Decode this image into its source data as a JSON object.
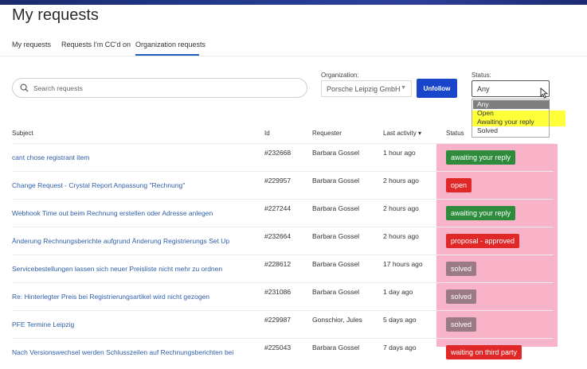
{
  "page_title": "My requests",
  "tabs": [
    {
      "label": "My requests"
    },
    {
      "label": "Requests I'm CC'd on"
    },
    {
      "label": "Organization requests"
    }
  ],
  "search": {
    "placeholder": "Search requests"
  },
  "organization": {
    "label": "Organization:",
    "value": "Porsche Leipzig GmbH"
  },
  "unfollow_label": "Unfollow",
  "status_filter": {
    "label": "Status:",
    "value": "Any",
    "options": [
      "Any",
      "Open",
      "Awaiting your reply",
      "Solved"
    ]
  },
  "table": {
    "headers": {
      "subject": "Subject",
      "id": "Id",
      "requester": "Requester",
      "last_activity": "Last activity ▾",
      "status": "Status"
    },
    "rows": [
      {
        "subject": "cant chose registrant item",
        "id": "#232668",
        "requester": "Barbara Gossel",
        "last_activity": "1 hour ago",
        "status": "awaiting your reply"
      },
      {
        "subject": "Change Request - Crystal Report Anpassung \"Rechnung\"",
        "id": "#229957",
        "requester": "Barbara Gossel",
        "last_activity": "2 hours ago",
        "status": "open"
      },
      {
        "subject": "Webhook Time out beim Rechnung erstellen oder Adresse anlegen",
        "id": "#227244",
        "requester": "Barbara Gossel",
        "last_activity": "2 hours ago",
        "status": "awaiting your reply"
      },
      {
        "subject": "Änderung Rechnungsberichte aufgrund Änderung Registrierungs Set Up",
        "id": "#232664",
        "requester": "Barbara Gossel",
        "last_activity": "2 hours ago",
        "status": "proposal - approved"
      },
      {
        "subject": "Servicebestellungen lassen sich neuer Preisliste nicht mehr zu ordnen",
        "id": "#228612",
        "requester": "Barbara Gossel",
        "last_activity": "17 hours ago",
        "status": "solved"
      },
      {
        "subject": "Re: Hinterlegter Preis bei Registrierungsartikel wird nicht gezogen",
        "id": "#231086",
        "requester": "Barbara Gossel",
        "last_activity": "1 day ago",
        "status": "solved"
      },
      {
        "subject": "PFE Termine Leipzig",
        "id": "#229987",
        "requester": "Gonschior, Jules",
        "last_activity": "5 days ago",
        "status": "solved"
      },
      {
        "subject": "Nach Versionswechsel werden Schlusszeilen auf Rechnungsberichten bei",
        "id": "#225043",
        "requester": "Barbara Gossel",
        "last_activity": "7 days ago",
        "status": "waiting on third party"
      }
    ]
  },
  "colors": {
    "awaiting": "#2e8b3c",
    "open": "#e02828",
    "proposal": "#e02828",
    "solved": "#9a7a84",
    "waiting": "#e02828",
    "highlight_yellow": "#ffff3a",
    "highlight_pink": "#f9b3c8",
    "link": "#2f5ea8",
    "button": "#1845c9"
  }
}
